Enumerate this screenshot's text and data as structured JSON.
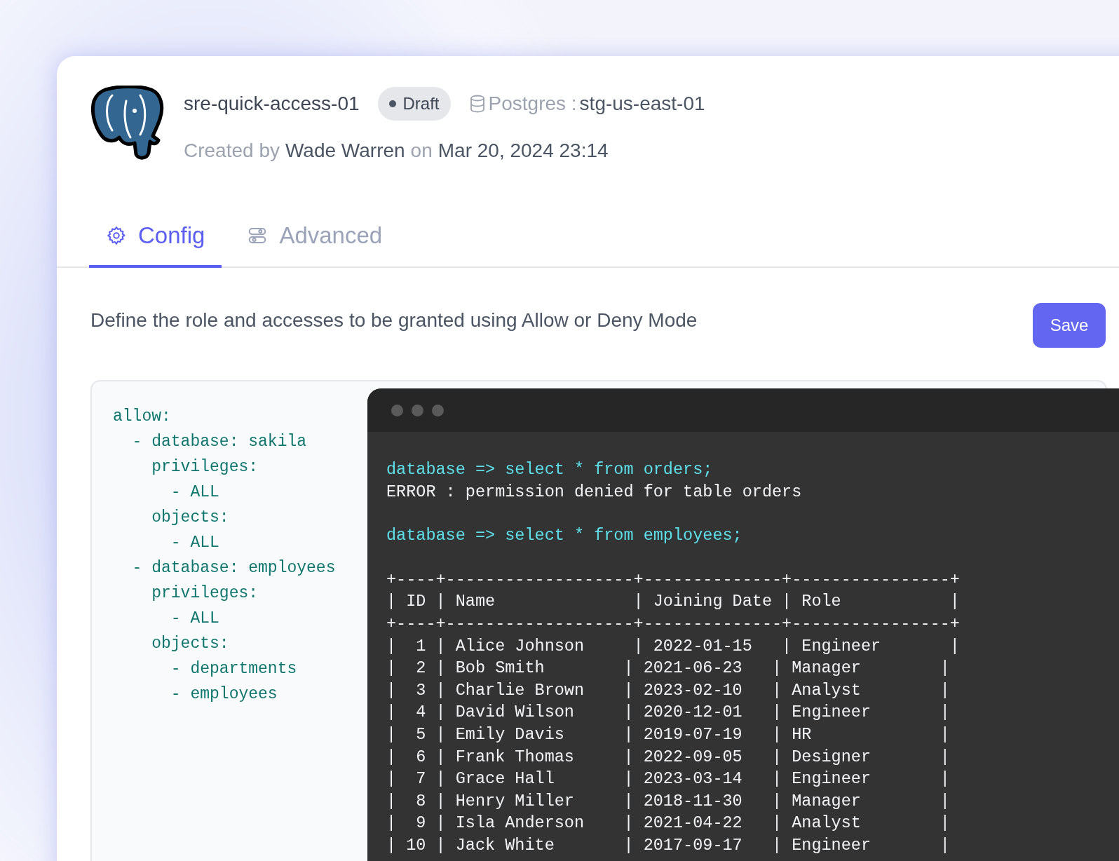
{
  "header": {
    "name": "sre-quick-access-01",
    "status": "Draft",
    "engine": "Postgres :",
    "instance": "stg-us-east-01",
    "created_label": "Created by",
    "author": "Wade Warren",
    "on_label": "on",
    "created_at": "Mar 20, 2024 23:14"
  },
  "tabs": [
    {
      "label": "Config",
      "kind": "gear",
      "selected": true
    },
    {
      "label": "Advanced",
      "kind": "toggles",
      "selected": false
    }
  ],
  "description": "Define the role and accesses to be granted using Allow or Deny Mode",
  "save_button": "Save",
  "yaml_lines": [
    "allow:",
    "  - database: sakila",
    "    privileges:",
    "      - ALL",
    "    objects:",
    "      - ALL",
    "  - database: employees",
    "    privileges:",
    "      - ALL",
    "    objects:",
    "      - departments",
    "      - employees"
  ],
  "terminal": {
    "lines": [
      {
        "kind": "command",
        "text": "database => select * from orders;"
      },
      {
        "kind": "output",
        "text": "ERROR : permission denied for table orders"
      },
      {
        "kind": "command",
        "text": "database => select * from employees;"
      },
      {
        "kind": "table",
        "text": "+----+-------------------+--------------+----------------+"
      },
      {
        "kind": "table",
        "text": "| ID | Name              | Joining Date | Role           |"
      },
      {
        "kind": "table",
        "text": "+----+-------------------+--------------+----------------+"
      },
      {
        "kind": "table",
        "text": "|  1 | Alice Johnson     | 2022-01-15   | Engineer       |"
      },
      {
        "kind": "table",
        "text": "|  2 | Bob Smith        | 2021-06-23   | Manager        |"
      },
      {
        "kind": "table",
        "text": "|  3 | Charlie Brown    | 2023-02-10   | Analyst        |"
      },
      {
        "kind": "table",
        "text": "|  4 | David Wilson     | 2020-12-01   | Engineer       |"
      },
      {
        "kind": "table",
        "text": "|  5 | Emily Davis      | 2019-07-19   | HR             |"
      },
      {
        "kind": "table",
        "text": "|  6 | Frank Thomas     | 2022-09-05   | Designer       |"
      },
      {
        "kind": "table",
        "text": "|  7 | Grace Hall       | 2023-03-14   | Engineer       |"
      },
      {
        "kind": "table",
        "text": "|  8 | Henry Miller     | 2018-11-30   | Manager        |"
      },
      {
        "kind": "table",
        "text": "|  9 | Isla Anderson    | 2021-04-22   | Analyst        |"
      },
      {
        "kind": "table",
        "text": "| 10 | Jack White       | 2017-09-17   | Engineer       |"
      }
    ]
  }
}
